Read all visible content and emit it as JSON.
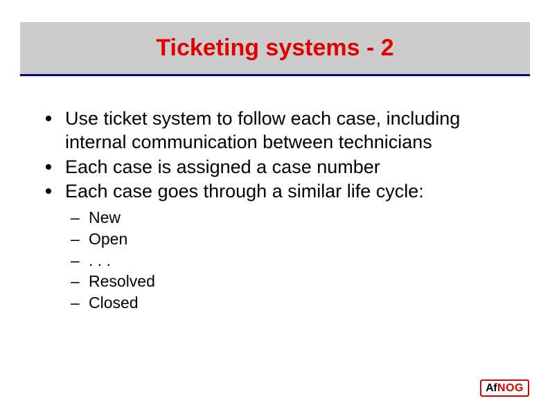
{
  "title": "Ticketing systems - 2",
  "bullets": [
    "Use ticket system to follow each case, including internal communication between technicians",
    "Each case is assigned a case number",
    "Each case goes through a similar life cycle:"
  ],
  "subbullets": [
    "New",
    "Open",
    ". . .",
    "Resolved",
    "Closed"
  ],
  "logo": {
    "part1": "Af",
    "part2": "NOG"
  }
}
